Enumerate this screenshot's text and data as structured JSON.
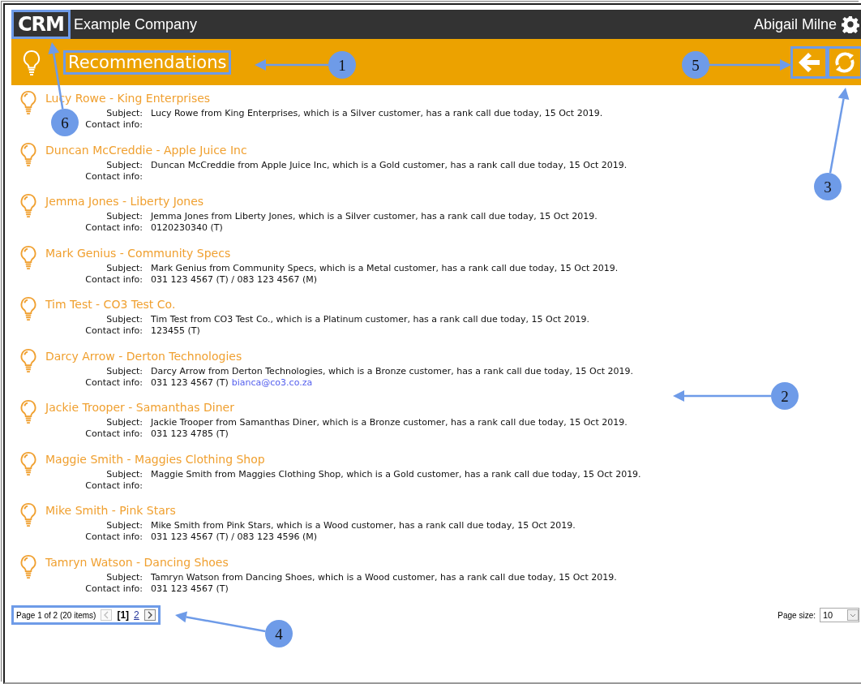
{
  "header": {
    "logo": "CRM",
    "company": "Example Company",
    "user": "Abigail Milne"
  },
  "page": {
    "title": "Recommendations"
  },
  "items": [
    {
      "name": "Lucy Rowe - King Enterprises",
      "subject_label": "Subject:",
      "subject": "Lucy Rowe from King Enterprises, which is a Silver customer, has a rank call due today, 15 Oct 2019.",
      "contact_label": "Contact info:"
    },
    {
      "name": "Duncan McCreddie - Apple Juice Inc",
      "subject_label": "Subject:",
      "subject": "Duncan McCreddie from Apple Juice Inc, which is a Gold customer, has a rank call due today, 15 Oct 2019.",
      "contact_label": "Contact info:"
    },
    {
      "name": "Jemma Jones - Liberty Jones",
      "subject_label": "Subject:",
      "subject": "Jemma Jones from Liberty Jones, which is a Silver customer, has a rank call due today, 15 Oct 2019.",
      "contact_label": "Contact info:",
      "contact": "0120230340 (T)"
    },
    {
      "name": "Mark Genius - Community Specs",
      "subject_label": "Subject:",
      "subject": "Mark Genius from Community Specs, which is a Metal customer, has a rank call due today, 15 Oct 2019.",
      "contact_label": "Contact info:",
      "contact": "031 123 4567 (T) / 083 123 4567 (M)"
    },
    {
      "name": "Tim Test - CO3 Test Co.",
      "subject_label": "Subject:",
      "subject": "Tim Test from CO3 Test Co., which is a Platinum customer, has a rank call due today, 15 Oct 2019.",
      "contact_label": "Contact info:",
      "contact": "123455 (T)"
    },
    {
      "name": "Darcy Arrow - Derton Technologies",
      "subject_label": "Subject:",
      "subject": "Darcy Arrow from Derton Technologies, which is a Bronze customer, has a rank call due today, 15 Oct 2019.",
      "contact_label": "Contact info:",
      "contact": "031 123 4567 (T)",
      "email": "bianca@co3.co.za"
    },
    {
      "name": "Jackie Trooper - Samanthas Diner",
      "subject_label": "Subject:",
      "subject": "Jackie Trooper from Samanthas Diner, which is a Bronze customer, has a rank call due today, 15 Oct 2019.",
      "contact_label": "Contact info:",
      "contact": "031 123 4785 (T)"
    },
    {
      "name": "Maggie Smith - Maggies Clothing Shop",
      "subject_label": "Subject:",
      "subject": "Maggie Smith from Maggies Clothing Shop, which is a Gold customer, has a rank call due today, 15 Oct 2019.",
      "contact_label": "Contact info:"
    },
    {
      "name": "Mike Smith - Pink Stars",
      "subject_label": "Subject:",
      "subject": "Mike Smith from Pink Stars, which is a Wood customer, has a rank call due today, 15 Oct 2019.",
      "contact_label": "Contact info:",
      "contact": "031 123 4567 (T) / 083 123 4596 (M)"
    },
    {
      "name": "Tamryn Watson - Dancing Shoes",
      "subject_label": "Subject:",
      "subject": "Tamryn Watson from Dancing Shoes, which is a Wood customer, has a rank call due today, 15 Oct 2019.",
      "contact_label": "Contact info:",
      "contact": "031 123 4567 (T)"
    }
  ],
  "pager": {
    "summary": "Page 1 of 2 (20 items)",
    "prev": {
      "disabled": true
    },
    "pages": [
      {
        "label": "[1]",
        "selected": true
      },
      {
        "label": "2",
        "selected": false
      }
    ],
    "next": {
      "disabled": false
    }
  },
  "page_size": {
    "label": "Page size:",
    "value": "10"
  },
  "callouts": [
    {
      "label": "1"
    },
    {
      "label": "2"
    },
    {
      "label": "3"
    },
    {
      "label": "4"
    },
    {
      "label": "5"
    },
    {
      "label": "6"
    }
  ]
}
